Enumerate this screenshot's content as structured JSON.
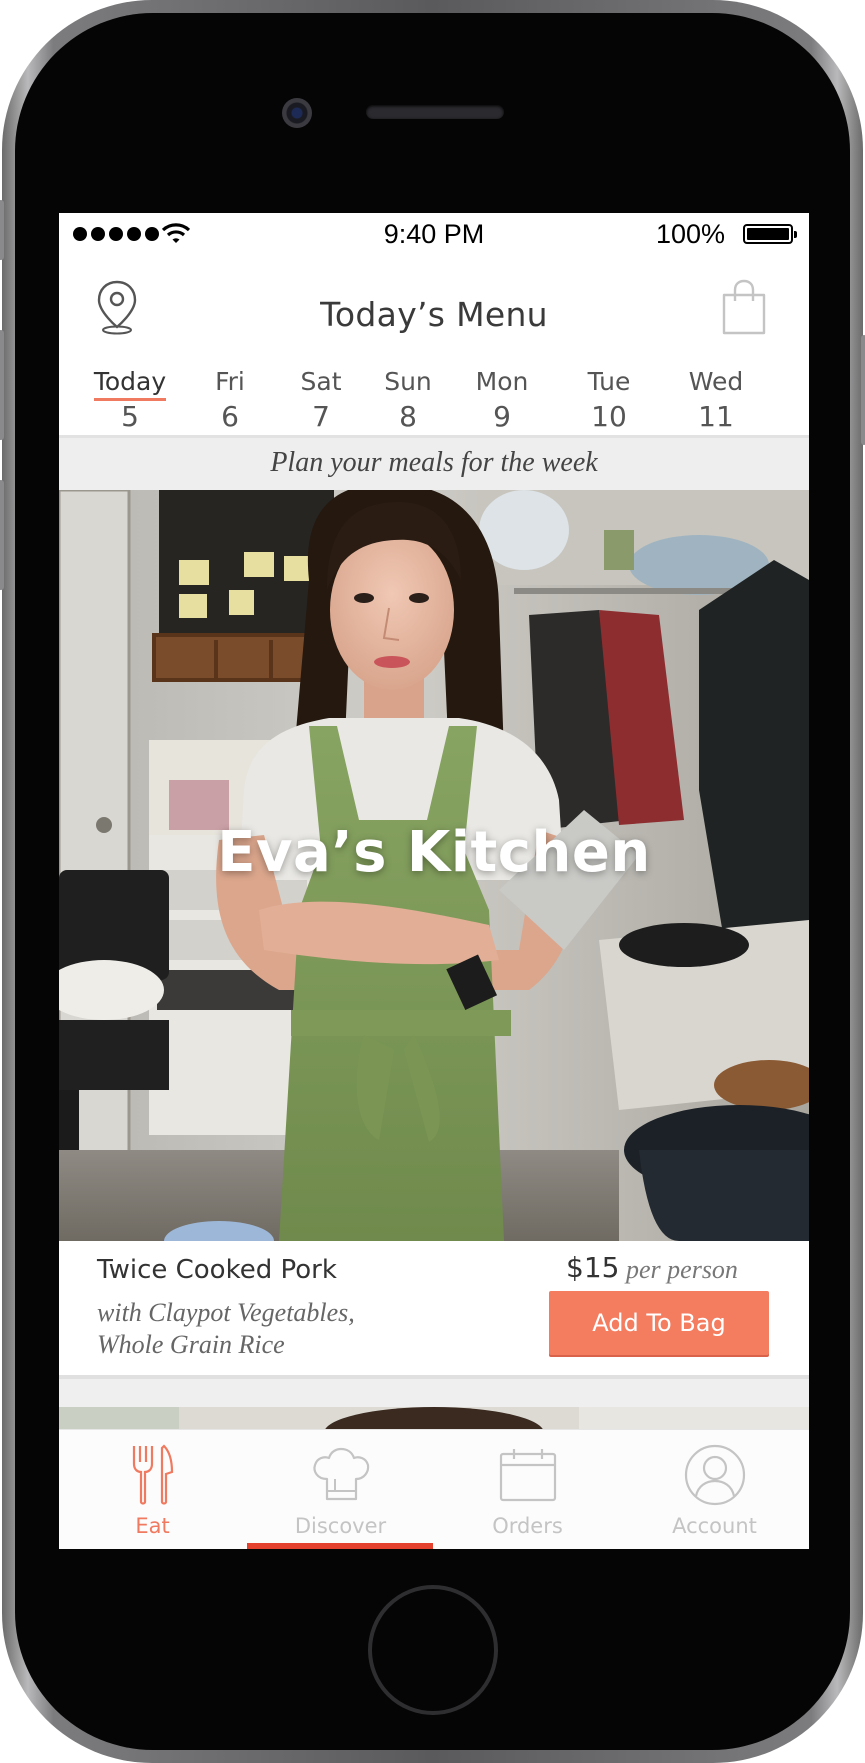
{
  "status_bar": {
    "time": "9:40 PM",
    "battery": "100%",
    "icons": [
      "signal-icon",
      "wifi-icon",
      "battery-icon"
    ]
  },
  "header": {
    "title": "Today’s Menu",
    "left_icon": "location-pin-icon",
    "right_icon": "shopping-bag-icon"
  },
  "days": [
    {
      "name": "Today",
      "num": "5",
      "active": true
    },
    {
      "name": "Fri",
      "num": "6"
    },
    {
      "name": "Sat",
      "num": "7"
    },
    {
      "name": "Sun",
      "num": "8"
    },
    {
      "name": "Mon",
      "num": "9"
    },
    {
      "name": "Tue",
      "num": "10"
    },
    {
      "name": "Wed",
      "num": "11"
    }
  ],
  "tagline": "Plan your meals for the week",
  "hero": {
    "title": "Eva’s Kitchen"
  },
  "meal": {
    "name": "Twice Cooked Pork",
    "sides_line1": "with Claypot Vegetables,",
    "sides_line2": "Whole Grain Rice",
    "price": "$15",
    "per": "per person",
    "add_label": "Add To Bag"
  },
  "tabs": [
    {
      "label": "Eat",
      "icon": "fork-knife-icon",
      "active": true
    },
    {
      "label": "Discover",
      "icon": "chef-hat-icon"
    },
    {
      "label": "Orders",
      "icon": "calendar-icon"
    },
    {
      "label": "Account",
      "icon": "user-icon"
    }
  ],
  "colors": {
    "accent": "#f47d60",
    "active_tab": "#f07a60",
    "indicator": "#e4412e"
  }
}
